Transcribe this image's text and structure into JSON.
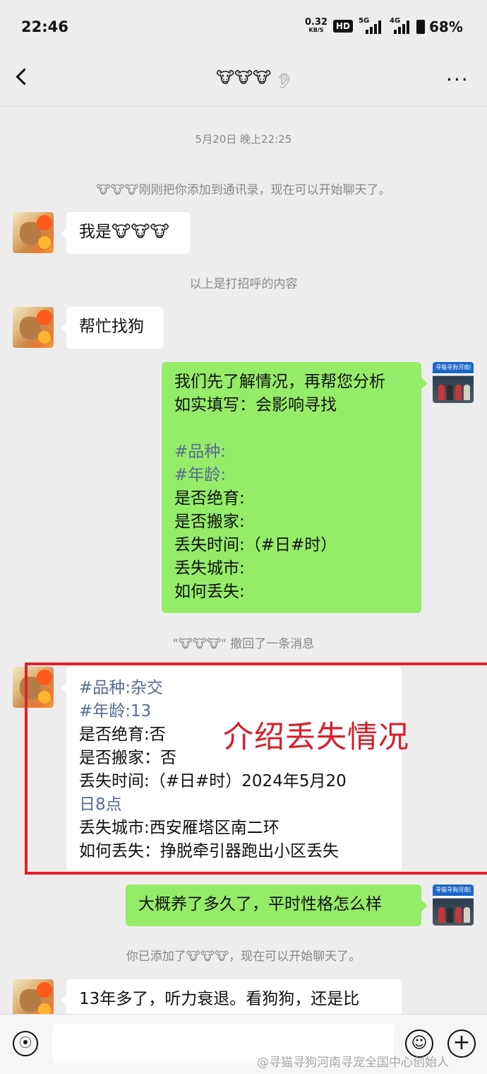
{
  "status_bar": {
    "time": "22:46",
    "speed_value": "0.32",
    "speed_unit": "KB/S",
    "hd_badge": "HD",
    "network_5g": "5G",
    "network_4g": "4G",
    "battery": "68%"
  },
  "header": {
    "title": "🐮🐮🐮",
    "ear_icon": "ear-icon",
    "more_label": "···"
  },
  "messages": {
    "timestamp": "5月20日 晚上22:25",
    "system_added": "🐮🐮🐮刚刚把你添加到通讯录，现在可以开始聊天了。",
    "m1": "我是🐮🐮🐮",
    "greeting_note": "以上是打招呼的内容",
    "m2": "帮忙找狗",
    "m3_lines": [
      "我们先了解情况，再帮您分析",
      "如实填写：会影响寻找",
      "",
      "#品种:",
      "#年龄:",
      "是否绝育:",
      "是否搬家:",
      "丢失时间:（#日#时）",
      "丢失城市:",
      "如何丢失:"
    ],
    "recall_note": "\"🐮🐮🐮\" 撤回了一条消息",
    "m4_lines": [
      "#品种:杂交",
      "#年龄:13",
      "是否绝育:否",
      "是否搬家：否",
      "丢失时间:（#日#时）2024年5月20",
      "日8点",
      "丢失城市:西安雁塔区南二环",
      "如何丢失：挣脱牵引器跑出小区丢失"
    ],
    "annotation": "介绍丢失情况",
    "m5": "大概养了多久了，平时性格怎么样",
    "system_added_2": "你已添加了🐮🐮🐮，现在可以开始聊天了。",
    "m6": "13年多了，听力衰退。看狗狗，还是比"
  },
  "team_avatar_banner": "寻猫寻狗河南团队",
  "watermark": "@寻猫寻狗河南寻宠全国中心创始人",
  "colors": {
    "background": "#ededed",
    "green_bubble": "#95ec69",
    "annotation_red": "#d81e2a",
    "link_blue": "#576b95"
  }
}
